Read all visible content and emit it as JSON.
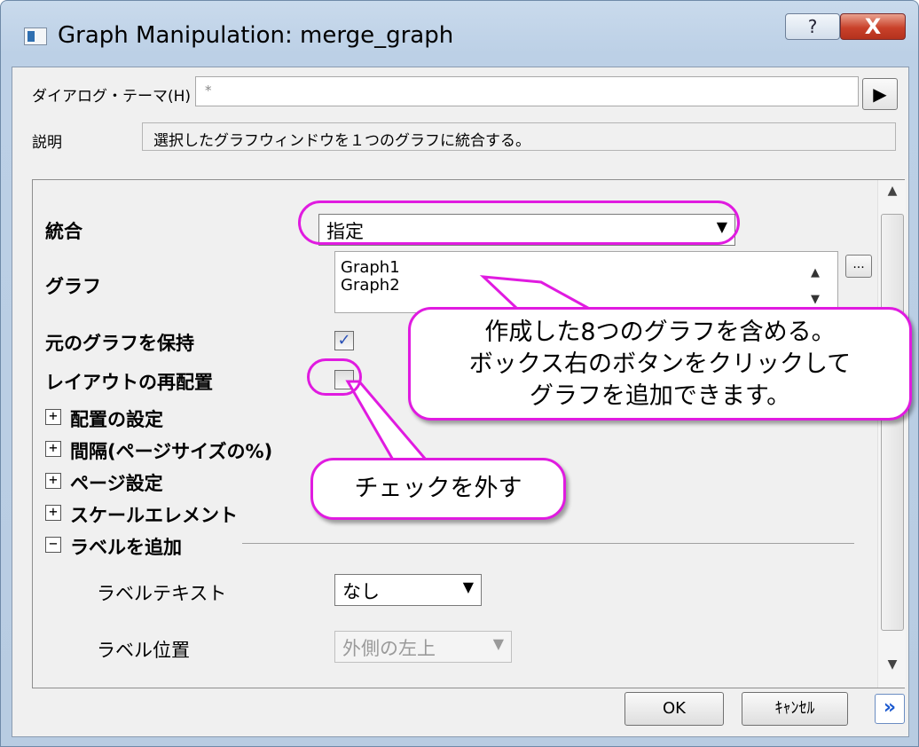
{
  "window": {
    "title": "Graph Manipulation: merge_graph",
    "help_label": "?",
    "close_label": "X"
  },
  "header": {
    "theme_label": "ダイアログ・テーマ(H)",
    "theme_value": "*",
    "theme_arrow": "▶",
    "desc_label": "説明",
    "desc_text": "選択したグラフウィンドウを１つのグラフに統合する。"
  },
  "settings": {
    "merge": {
      "label": "統合",
      "value": "指定"
    },
    "graphs": {
      "label": "グラフ",
      "items": [
        "Graph1",
        "Graph2"
      ],
      "browse_label": "..."
    },
    "keep_source": {
      "label": "元のグラフを保持",
      "checked": true
    },
    "rearrange": {
      "label": "レイアウトの再配置",
      "checked": false
    },
    "sections": {
      "arrange": "配置の設定",
      "spacing": "間隔(ページサイズの%)",
      "page_setup": "ページ設定",
      "scale_elements": "スケールエレメント",
      "add_label": "ラベルを追加"
    },
    "label_text": {
      "label": "ラベルテキスト",
      "value": "なし"
    },
    "label_position": {
      "label": "ラベル位置",
      "value": "外側の左上"
    }
  },
  "footer": {
    "ok_label": "OK",
    "cancel_label": "ｷｬﾝｾﾙ",
    "more_label": "»"
  },
  "annotations": {
    "callout_graphs_line1": "作成した8つのグラフを含める。",
    "callout_graphs_line2": "ボックス右のボタンをクリックして",
    "callout_graphs_line3": "グラフを追加できます。",
    "callout_uncheck": "チェックを外す",
    "highlight_color": "#e01be0"
  }
}
